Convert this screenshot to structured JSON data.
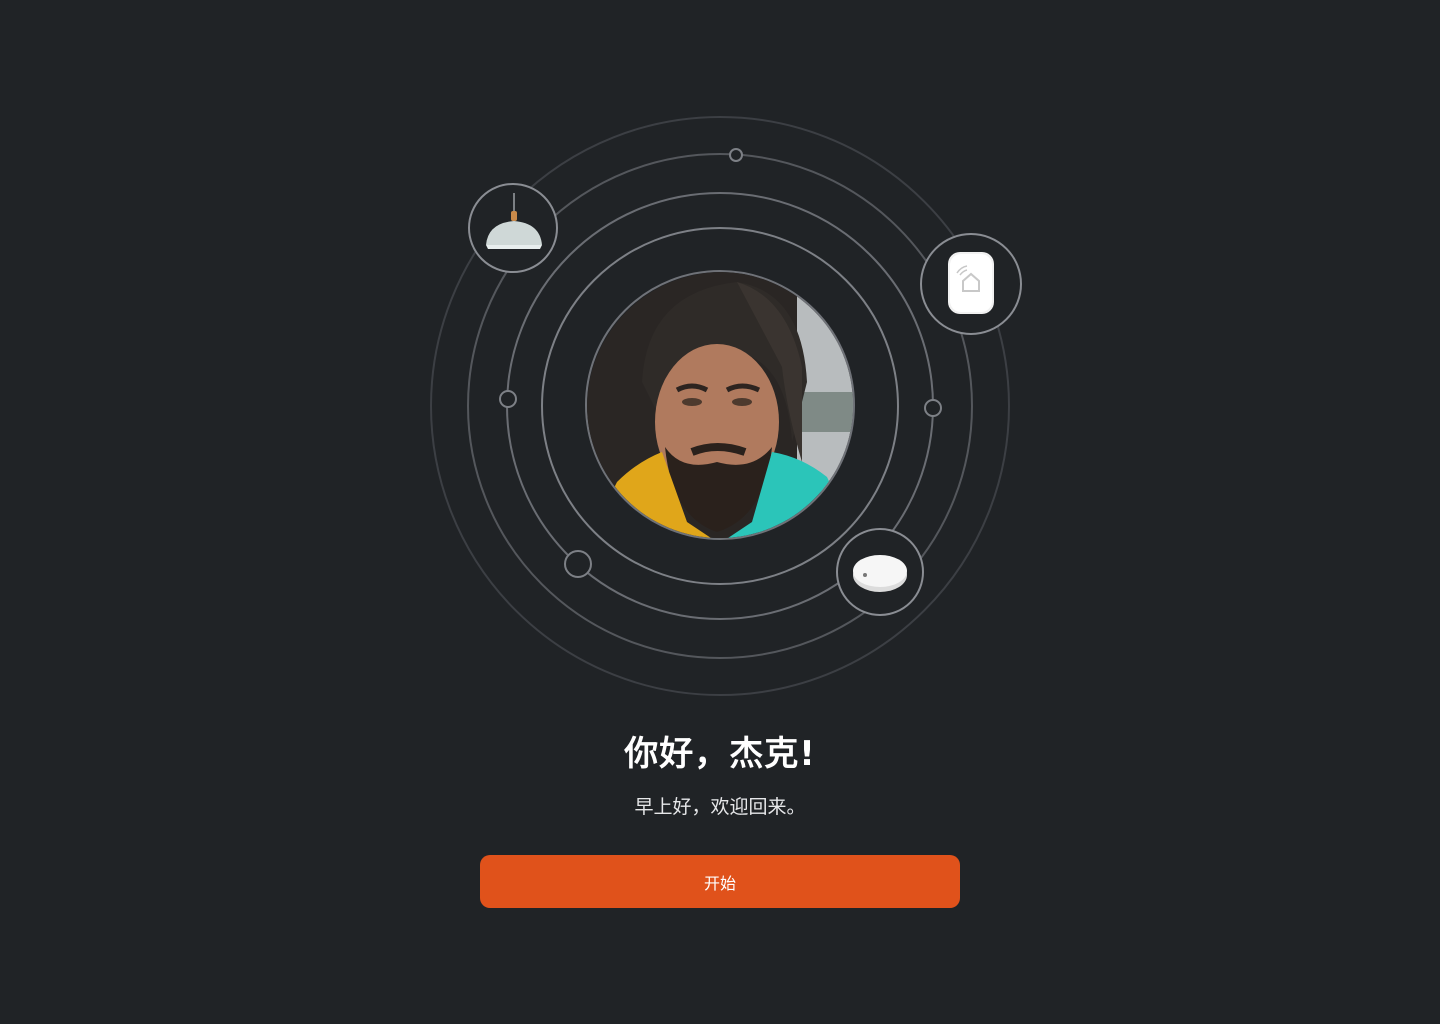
{
  "greeting": {
    "title": "你好，杰克!",
    "subtitle": "早上好，欢迎回来。"
  },
  "actions": {
    "start_label": "开始"
  },
  "devices": [
    {
      "icon": "pendant-lamp-icon"
    },
    {
      "icon": "smart-home-hub-icon"
    },
    {
      "icon": "round-sensor-icon"
    }
  ],
  "colors": {
    "background": "#202326",
    "accent": "#e0521b",
    "orbit": "#6f7278"
  }
}
